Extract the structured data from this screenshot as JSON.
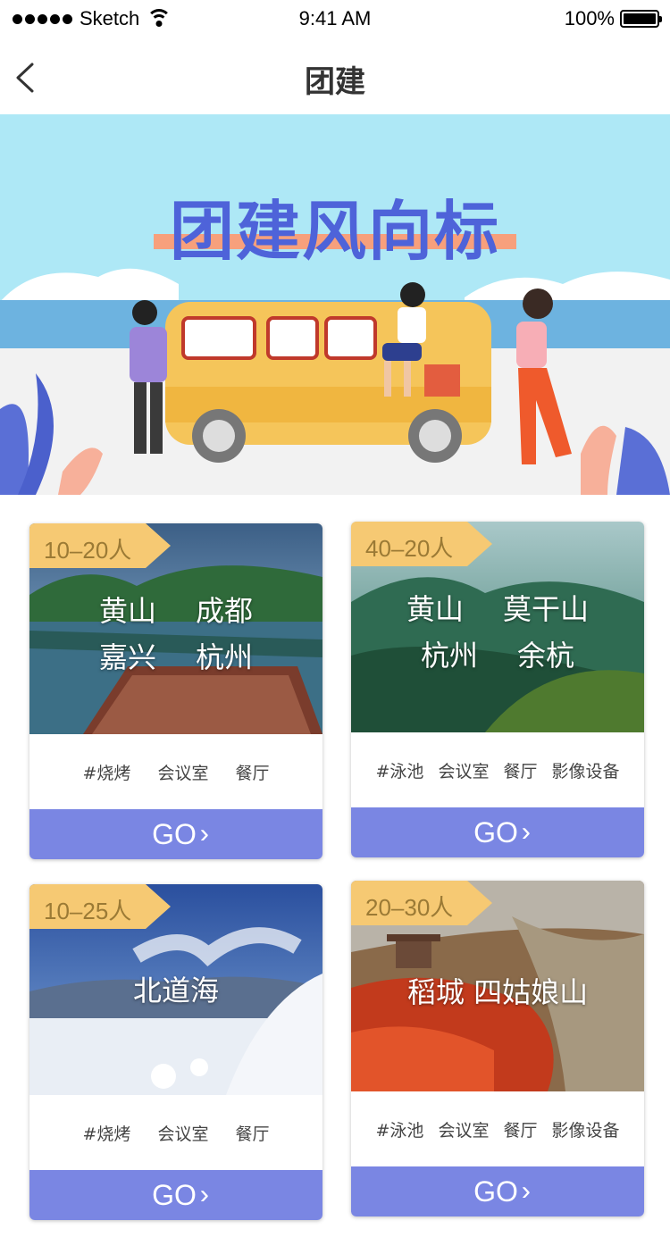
{
  "status_bar": {
    "carrier": "Sketch",
    "time": "9:41 AM",
    "battery": "100%"
  },
  "nav": {
    "title": "团建",
    "back_icon": "chevron-left-icon"
  },
  "banner": {
    "title": "团建风向标"
  },
  "cards": [
    {
      "badge": "10–20人",
      "places": [
        [
          "黄山",
          "成都"
        ],
        [
          "嘉兴",
          "杭州"
        ]
      ],
      "tags": [
        "#烧烤",
        "会议室",
        "餐厅"
      ],
      "go": "GO"
    },
    {
      "badge": "40–20人",
      "places": [
        [
          "黄山",
          "莫干山"
        ],
        [
          "杭州",
          "余杭"
        ]
      ],
      "tags": [
        "#泳池",
        "会议室",
        "餐厅",
        "影像设备"
      ],
      "go": "GO"
    },
    {
      "badge": "10–25人",
      "places_single": "北道海",
      "tags": [
        "#烧烤",
        "会议室",
        "餐厅"
      ],
      "go": "GO"
    },
    {
      "badge": "20–30人",
      "places_single": "稻城 四姑娘山",
      "tags": [
        "#泳池",
        "会议室",
        "餐厅",
        "影像设备"
      ],
      "go": "GO"
    }
  ],
  "colors": {
    "accent": "#7a86e3",
    "badge": "#f6c973",
    "banner_title": "#4e63d9",
    "banner_bg": "#aee8f6"
  }
}
